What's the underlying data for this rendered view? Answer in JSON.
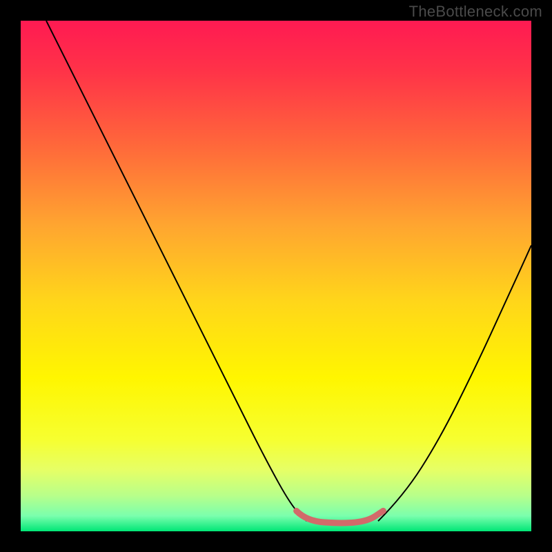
{
  "watermark": "TheBottleneck.com",
  "chart_data": {
    "type": "line",
    "title": "",
    "xlabel": "",
    "ylabel": "",
    "xlim": [
      0,
      100
    ],
    "ylim": [
      0,
      100
    ],
    "grid": false,
    "background_gradient": {
      "stops": [
        {
          "pos": 0.0,
          "color": "#ff1a52"
        },
        {
          "pos": 0.1,
          "color": "#ff3348"
        },
        {
          "pos": 0.25,
          "color": "#ff6a3a"
        },
        {
          "pos": 0.4,
          "color": "#ffa530"
        },
        {
          "pos": 0.55,
          "color": "#ffd61a"
        },
        {
          "pos": 0.7,
          "color": "#fff600"
        },
        {
          "pos": 0.82,
          "color": "#f6ff30"
        },
        {
          "pos": 0.88,
          "color": "#e6ff66"
        },
        {
          "pos": 0.93,
          "color": "#b8ff8a"
        },
        {
          "pos": 0.97,
          "color": "#7affad"
        },
        {
          "pos": 1.0,
          "color": "#00e676"
        }
      ]
    },
    "series": [
      {
        "name": "left-curve",
        "color": "#000000",
        "width": 2,
        "points": [
          {
            "x": 5,
            "y": 100
          },
          {
            "x": 10,
            "y": 90
          },
          {
            "x": 18,
            "y": 74
          },
          {
            "x": 26,
            "y": 58
          },
          {
            "x": 34,
            "y": 42
          },
          {
            "x": 42,
            "y": 26
          },
          {
            "x": 48,
            "y": 14
          },
          {
            "x": 53,
            "y": 5
          },
          {
            "x": 56,
            "y": 2
          }
        ]
      },
      {
        "name": "right-curve",
        "color": "#000000",
        "width": 2,
        "points": [
          {
            "x": 70,
            "y": 2
          },
          {
            "x": 75,
            "y": 7
          },
          {
            "x": 82,
            "y": 18
          },
          {
            "x": 89,
            "y": 32
          },
          {
            "x": 95,
            "y": 45
          },
          {
            "x": 100,
            "y": 56
          }
        ]
      },
      {
        "name": "valley-flat",
        "color": "#d26a6a",
        "width": 9,
        "cap": "round",
        "points": [
          {
            "x": 54,
            "y": 4
          },
          {
            "x": 56,
            "y": 2
          },
          {
            "x": 63,
            "y": 1.5
          },
          {
            "x": 68,
            "y": 2
          },
          {
            "x": 71,
            "y": 4
          }
        ]
      }
    ]
  }
}
